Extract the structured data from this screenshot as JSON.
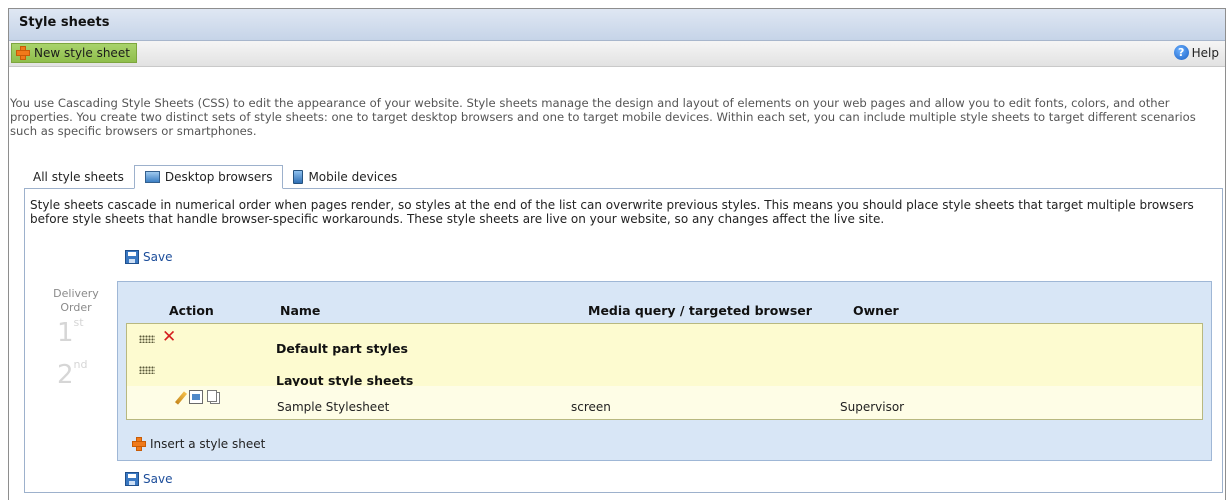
{
  "page": {
    "title": "Style sheets"
  },
  "toolbar": {
    "new_label": "New style sheet",
    "help_label": "Help"
  },
  "intro": "You use Cascading Style Sheets (CSS) to edit the appearance of your website. Style sheets manage the design and layout of elements on your web pages and allow you to edit fonts, colors, and other properties. You create two distinct sets of style sheets: one to target desktop browsers and one to target mobile devices. Within each set, you can include multiple style sheets to target different scenarios such as specific browsers or smartphones.",
  "tabs": [
    {
      "label": "All style sheets",
      "active": false
    },
    {
      "label": "Desktop browsers",
      "active": true,
      "icon": "monitor-icon"
    },
    {
      "label": "Mobile devices",
      "active": false,
      "icon": "phone-icon"
    }
  ],
  "panel": {
    "description": "Style sheets cascade in numerical order when pages render, so styles at the end of the list can overwrite previous styles. This means you should place style sheets that target multiple browsers before style sheets that handle browser-specific workarounds. These style sheets are live on your website, so any changes affect the live site.",
    "save_label": "Save",
    "delivery_order_label": "Delivery Order",
    "orders": [
      {
        "num": "1",
        "suffix": "st"
      },
      {
        "num": "2",
        "suffix": "nd"
      }
    ],
    "columns": {
      "action": "Action",
      "name": "Name",
      "media": "Media query / targeted browser",
      "owner": "Owner"
    },
    "rows": [
      {
        "title": "Default part styles",
        "deletable": true
      },
      {
        "title": "Layout style sheets",
        "deletable": false,
        "items": [
          {
            "name": "Sample Stylesheet",
            "media": "screen",
            "owner": "Supervisor"
          }
        ]
      }
    ],
    "insert_label": "Insert a style sheet"
  },
  "colors": {
    "accent_green": "#9bc95a",
    "header_blue": "#c6d4e8",
    "row_yellow": "#fdfbd0",
    "table_bg": "#d8e6f6",
    "delete_red": "#d41f1f"
  }
}
